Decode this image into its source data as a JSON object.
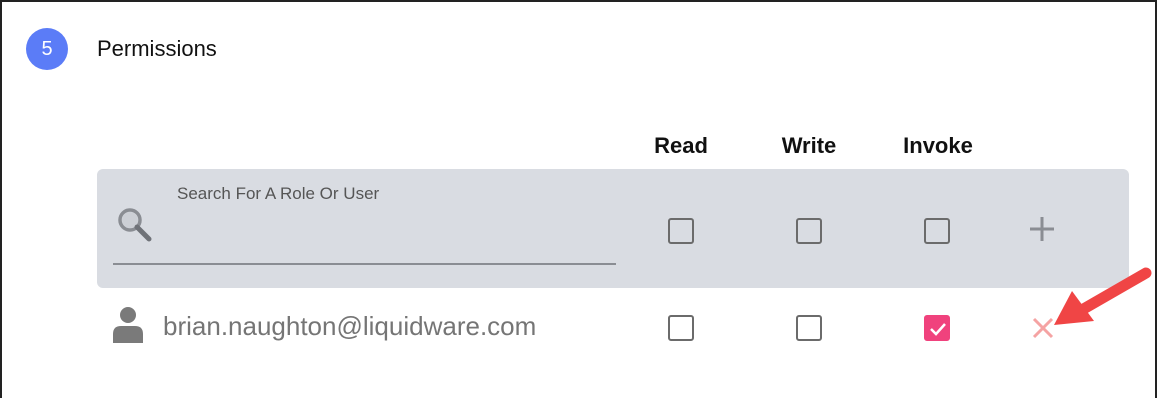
{
  "section": {
    "step_number": "5",
    "title": "Permissions"
  },
  "columns": [
    "Read",
    "Write",
    "Invoke"
  ],
  "search": {
    "placeholder": "Search For A Role Or User",
    "value": "",
    "icon": "search-icon",
    "new_entry": {
      "read": false,
      "write": false,
      "invoke": false
    },
    "add_icon": "plus-icon"
  },
  "users": [
    {
      "icon": "user-icon",
      "email": "brian.naughton@liquidware.com",
      "read": false,
      "write": false,
      "invoke": true,
      "remove_icon": "close-icon"
    }
  ],
  "colors": {
    "badge": "#5b7cf7",
    "checked": "#f0427d",
    "remove": "#f5a3a3",
    "annotation_arrow": "#f04545",
    "panel": "#d9dce2"
  }
}
